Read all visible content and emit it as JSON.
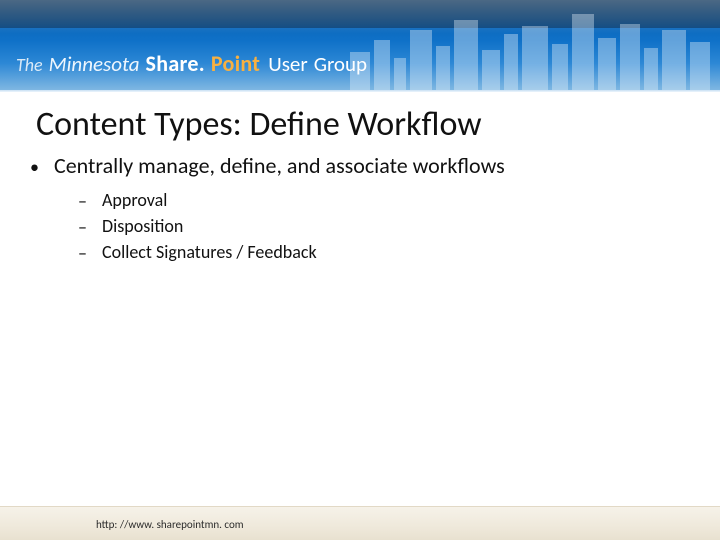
{
  "header": {
    "brand": {
      "the": "The",
      "minnesota": "Minnesota",
      "share": "Share.",
      "point": "Point",
      "user": "User",
      "group": "Group"
    }
  },
  "title": "Content Types: Define Workflow",
  "body": {
    "bullet1": "Centrally manage, define, and associate workflows",
    "sub": {
      "a": "Approval",
      "b": "Disposition",
      "c": "Collect Signatures / Feedback"
    }
  },
  "footer": {
    "url": "http: //www. sharepointmn. com"
  }
}
